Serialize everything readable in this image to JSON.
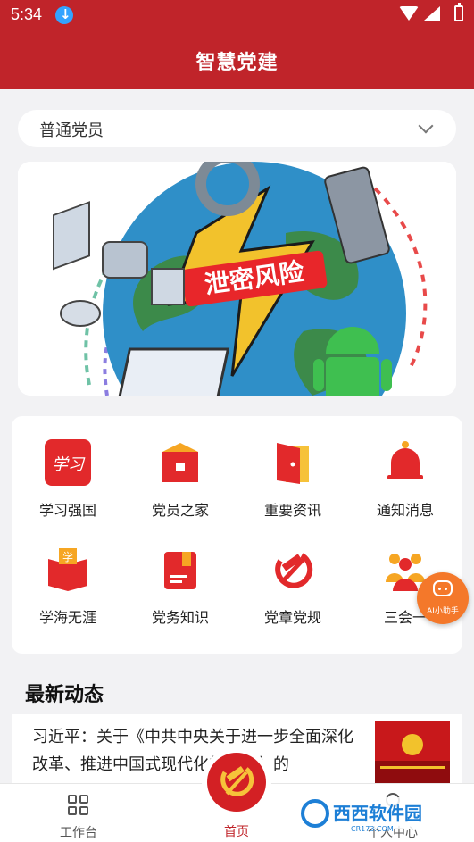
{
  "status_bar": {
    "time": "5:34"
  },
  "header": {
    "title": "智慧党建"
  },
  "role_select": {
    "value": "普通党员"
  },
  "banner": {
    "caption": "泄密风险"
  },
  "grid": {
    "items": [
      {
        "label": "学习强国",
        "icon": "xuexi-qiangguo-icon"
      },
      {
        "label": "党员之家",
        "icon": "home-icon"
      },
      {
        "label": "重要资讯",
        "icon": "door-icon"
      },
      {
        "label": "通知消息",
        "icon": "bell-icon"
      },
      {
        "label": "学海无涯",
        "icon": "book-icon"
      },
      {
        "label": "党务知识",
        "icon": "folder-icon"
      },
      {
        "label": "党章党规",
        "icon": "party-emblem-icon"
      },
      {
        "label": "三会一",
        "icon": "people-icon"
      }
    ],
    "icon_badge_xuexi": "学习",
    "icon_badge_xue": "学"
  },
  "ai_assistant": {
    "label": "AI小助手"
  },
  "news": {
    "section_title": "最新动态",
    "items": [
      {
        "title": "习近平：关于《中共中央关于进一步全面深化改革、推进中国式现代化的决定》的"
      }
    ]
  },
  "bottom_nav": {
    "workbench": "工作台",
    "home": "首页",
    "profile": "个人中心"
  },
  "watermark": {
    "text": "西西软件园",
    "sub": "CR173.COM"
  },
  "colors": {
    "primary": "#c0242a",
    "accent": "#f4782a",
    "background": "#f2f2f4"
  }
}
